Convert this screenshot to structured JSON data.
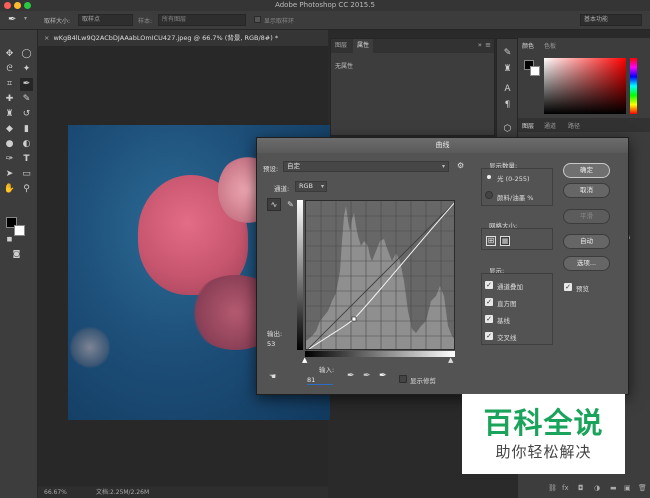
{
  "app": {
    "title": "Adobe Photoshop CC 2015.5"
  },
  "options_bar": {
    "sample_size_label": "取样大小:",
    "sample_size_value": "取样点",
    "sample_label": "样本:",
    "sample_value": "所有图层",
    "show_ring_label": "显示取样环",
    "workspace": "基本功能"
  },
  "document": {
    "tab_title": "wKgB4lLw9Q2ACbDJAAabLOmICU427.jpeg @ 66.7% (背景, RGB/8#) *",
    "zoom": "66.67%",
    "doc_size": "文档:2.25M/2.26M"
  },
  "properties_panel": {
    "tab_adjust": "图层",
    "tab_properties": "属性",
    "content": "无属性"
  },
  "color_panel": {
    "tab_color": "颜色",
    "tab_swatches": "色板"
  },
  "layers_panel": {
    "tab_layers": "图层",
    "tab_channels": "通道",
    "tab_paths": "路径",
    "opacity_partial": "度 1"
  },
  "dialog": {
    "title": "曲线",
    "preset_label": "预设:",
    "preset_value": "自定",
    "channel_label": "通道:",
    "channel_value": "RGB",
    "output_label": "输出:",
    "output_value": "53",
    "input_label": "输入:",
    "input_value": "81",
    "show_clipping_label": "显示修剪",
    "display_amount_label": "显示数量:",
    "light_option": "光 (0-255)",
    "pigment_option": "颜料/油墨 %",
    "grid_size_label": "网格大小:",
    "show_label": "显示:",
    "show_options": [
      "通道叠加",
      "直方图",
      "基线",
      "交叉线"
    ],
    "buttons": {
      "ok": "确定",
      "cancel": "取消",
      "smooth": "平滑",
      "auto": "自动",
      "options": "选项..."
    },
    "preview_label": "预览"
  },
  "watermark": {
    "line1": "百科全说",
    "line2": "助你轻松解决"
  },
  "colors": {
    "dialog_bg": "#535353",
    "panel_bg": "#3d3d3d",
    "watermark_green": "#1aa35a"
  }
}
